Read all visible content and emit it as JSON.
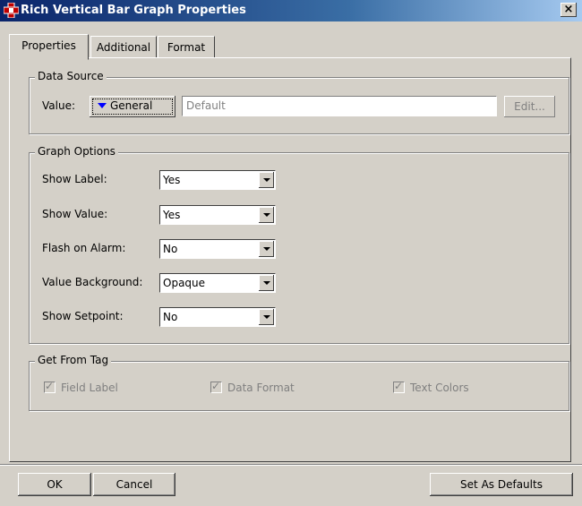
{
  "window": {
    "title": "Rich Vertical Bar Graph Properties",
    "close_label": "×",
    "title_icon": "plus-gear-icon"
  },
  "tabs": [
    {
      "label": "Properties",
      "active": true
    },
    {
      "label": "Additional",
      "active": false
    },
    {
      "label": "Format",
      "active": false
    }
  ],
  "data_source": {
    "legend": "Data Source",
    "value_label": "Value:",
    "general_button": "General",
    "value_field": "Default",
    "edit_button": "Edit..."
  },
  "graph_options": {
    "legend": "Graph Options",
    "rows": [
      {
        "label": "Show Label:",
        "value": "Yes"
      },
      {
        "label": "Show Value:",
        "value": "Yes"
      },
      {
        "label": "Flash on Alarm:",
        "value": "No"
      },
      {
        "label": "Value Background:",
        "value": "Opaque"
      },
      {
        "label": "Show Setpoint:",
        "value": "No"
      }
    ]
  },
  "get_from_tag": {
    "legend": "Get From Tag",
    "checks": [
      {
        "label": "Field Label",
        "checked": true
      },
      {
        "label": "Data Format",
        "checked": true
      },
      {
        "label": "Text Colors",
        "checked": true
      }
    ]
  },
  "buttons": {
    "ok": "OK",
    "cancel": "Cancel",
    "set_defaults": "Set As Defaults"
  }
}
